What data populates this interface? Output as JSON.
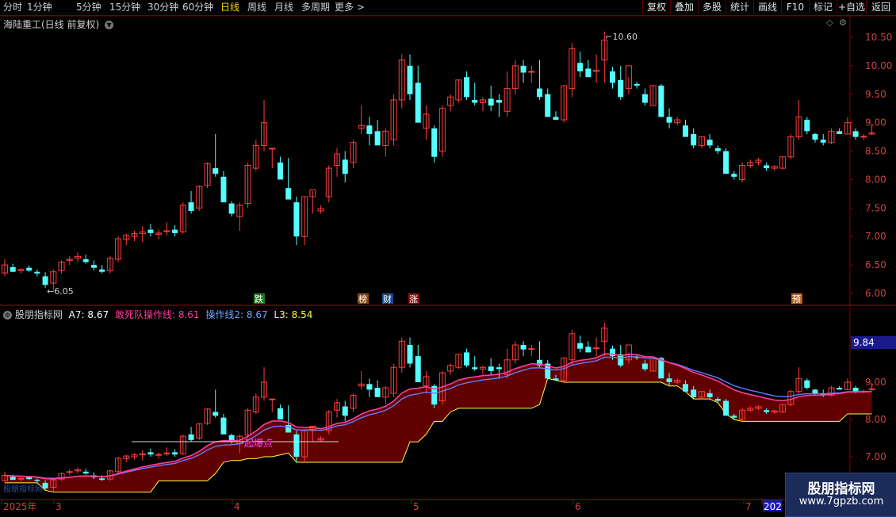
{
  "toolbar": {
    "periods": [
      "分时",
      "1分钟",
      "5分钟",
      "15分钟",
      "30分钟",
      "60分钟",
      "日线",
      "周线",
      "月线",
      "多周期",
      "更多 >"
    ],
    "active_period": "日线",
    "right_buttons": [
      "复权",
      "叠加",
      "多股",
      "统计",
      "画线",
      "F10",
      "标记",
      "+自选",
      "返回"
    ]
  },
  "main_pane": {
    "title": "海陆重工(日线 前复权)",
    "max_label": "10.60",
    "min_label": "6.05",
    "price_ticks": [
      "10.50",
      "10.00",
      "9.50",
      "9.00",
      "8.50",
      "8.00",
      "7.50",
      "7.00",
      "6.50",
      "6.00"
    ],
    "event_markers": [
      {
        "text": "跌",
        "bg": "#1f7a1f"
      },
      {
        "text": "榜",
        "bg": "#8a4a10"
      },
      {
        "text": "财",
        "bg": "#1f4a8a"
      },
      {
        "text": "涨",
        "bg": "#8a1010"
      },
      {
        "text": "预",
        "bg": "#b8601a"
      }
    ]
  },
  "indicator_pane": {
    "name": "股朋指标网",
    "values": [
      {
        "label": "A7:",
        "value": "8.67",
        "color": "#ffffff"
      },
      {
        "label": "敢死队操作线:",
        "value": "8.61",
        "color": "#ff3c9a"
      },
      {
        "label": "操作线2:",
        "value": "8.67",
        "color": "#6aa8ff"
      },
      {
        "label": "L3:",
        "value": "8.54",
        "color": "#ffff40"
      }
    ],
    "current_value": "9.84",
    "price_ticks": [
      "9.00",
      "8.00",
      "7.00"
    ],
    "annotation": "起爆点",
    "bottom_note": "股朋指标网"
  },
  "date_axis": [
    "2025年",
    "3",
    "4",
    "5",
    "6",
    "7",
    "202"
  ],
  "colors": {
    "up": "#ff3c3c",
    "down": "#54ffff",
    "bg": "#000000",
    "grid": "#7a0000",
    "ma": "#ff3c9a",
    "ma2": "#6a7aff",
    "l3": "#ffff40",
    "fill": "#6a0000"
  },
  "chart_data": {
    "type": "candlestick",
    "ohlc": [
      [
        6.36,
        6.6,
        6.3,
        6.5
      ],
      [
        6.46,
        6.52,
        6.38,
        6.38
      ],
      [
        6.4,
        6.44,
        6.35,
        6.42
      ],
      [
        6.45,
        6.49,
        6.38,
        6.4
      ],
      [
        6.38,
        6.42,
        6.3,
        6.35
      ],
      [
        6.3,
        6.37,
        6.1,
        6.15
      ],
      [
        6.18,
        6.42,
        6.05,
        6.38
      ],
      [
        6.4,
        6.58,
        6.35,
        6.55
      ],
      [
        6.58,
        6.66,
        6.5,
        6.6
      ],
      [
        6.62,
        6.72,
        6.55,
        6.65
      ],
      [
        6.6,
        6.68,
        6.52,
        6.55
      ],
      [
        6.5,
        6.58,
        6.4,
        6.45
      ],
      [
        6.42,
        6.5,
        6.35,
        6.38
      ],
      [
        6.4,
        6.65,
        6.35,
        6.62
      ],
      [
        6.6,
        7.0,
        6.55,
        6.96
      ],
      [
        6.95,
        7.05,
        6.85,
        7.02
      ],
      [
        7.0,
        7.1,
        6.92,
        7.05
      ],
      [
        7.05,
        7.18,
        6.9,
        7.08
      ],
      [
        7.12,
        7.22,
        7.0,
        7.06
      ],
      [
        7.04,
        7.12,
        6.95,
        7.06
      ],
      [
        7.1,
        7.25,
        7.02,
        7.1
      ],
      [
        7.12,
        7.2,
        7.0,
        7.06
      ],
      [
        7.08,
        7.6,
        7.05,
        7.55
      ],
      [
        7.6,
        7.8,
        7.4,
        7.45
      ],
      [
        7.5,
        7.9,
        7.45,
        7.88
      ],
      [
        7.9,
        8.3,
        7.85,
        8.28
      ],
      [
        8.2,
        8.8,
        8.05,
        8.1
      ],
      [
        8.05,
        8.15,
        7.7,
        7.6
      ],
      [
        7.58,
        7.62,
        7.35,
        7.4
      ],
      [
        7.35,
        7.6,
        7.1,
        7.55
      ],
      [
        7.58,
        8.3,
        7.5,
        8.25
      ],
      [
        8.2,
        8.7,
        8.15,
        8.6
      ],
      [
        8.6,
        9.4,
        8.5,
        9.0
      ],
      [
        8.55,
        8.55,
        8.2,
        8.55
      ],
      [
        8.3,
        8.4,
        8.1,
        8.0
      ],
      [
        7.85,
        8.38,
        7.65,
        7.65
      ],
      [
        7.6,
        7.7,
        6.85,
        7.0
      ],
      [
        7.0,
        7.7,
        6.85,
        7.7
      ],
      [
        7.7,
        7.8,
        7.4,
        7.82
      ],
      [
        7.45,
        7.55,
        7.4,
        7.49
      ],
      [
        7.7,
        8.25,
        7.6,
        8.2
      ],
      [
        8.25,
        8.55,
        8.05,
        8.45
      ],
      [
        8.35,
        8.5,
        7.95,
        8.1
      ],
      [
        8.3,
        8.7,
        8.2,
        8.65
      ],
      [
        8.9,
        9.3,
        8.8,
        8.95
      ],
      [
        8.95,
        9.1,
        8.6,
        8.8
      ],
      [
        8.85,
        9.05,
        8.6,
        8.6
      ],
      [
        8.6,
        8.9,
        8.4,
        8.85
      ],
      [
        8.7,
        9.5,
        8.6,
        9.4
      ],
      [
        9.4,
        10.2,
        9.25,
        10.1
      ],
      [
        10.0,
        10.2,
        9.4,
        9.5
      ],
      [
        9.7,
        10.0,
        9.05,
        9.0
      ],
      [
        8.9,
        9.3,
        8.7,
        9.15
      ],
      [
        8.9,
        8.95,
        8.3,
        8.4
      ],
      [
        8.5,
        9.3,
        8.4,
        9.25
      ],
      [
        9.3,
        9.5,
        9.2,
        9.45
      ],
      [
        9.4,
        9.75,
        9.35,
        9.75
      ],
      [
        9.8,
        9.9,
        9.4,
        9.45
      ],
      [
        9.4,
        9.7,
        9.3,
        9.35
      ],
      [
        9.35,
        9.45,
        9.2,
        9.4
      ],
      [
        9.42,
        9.65,
        9.2,
        9.3
      ],
      [
        9.4,
        9.5,
        9.1,
        9.35
      ],
      [
        9.2,
        9.9,
        9.1,
        9.6
      ],
      [
        9.6,
        10.1,
        9.5,
        10.0
      ],
      [
        10.0,
        10.1,
        9.7,
        9.88
      ],
      [
        9.9,
        10.0,
        9.7,
        9.9
      ],
      [
        9.6,
        10.1,
        9.4,
        9.45
      ],
      [
        9.5,
        9.6,
        9.2,
        9.1
      ],
      [
        9.1,
        9.2,
        9.05,
        9.05
      ],
      [
        9.05,
        9.65,
        9.0,
        9.65
      ],
      [
        9.6,
        10.4,
        9.45,
        10.3
      ],
      [
        10.05,
        10.25,
        9.8,
        9.9
      ],
      [
        9.95,
        10.1,
        9.8,
        9.8
      ],
      [
        9.9,
        10.2,
        9.7,
        9.92
      ],
      [
        10.1,
        10.6,
        9.7,
        10.45
      ],
      [
        9.9,
        9.98,
        9.6,
        9.7
      ],
      [
        9.75,
        10.0,
        9.4,
        9.45
      ],
      [
        9.6,
        9.8,
        9.5,
        10.0
      ],
      [
        9.68,
        9.72,
        9.6,
        9.65
      ],
      [
        9.5,
        9.6,
        9.3,
        9.35
      ],
      [
        9.3,
        9.65,
        9.3,
        9.65
      ],
      [
        9.65,
        9.68,
        9.15,
        9.1
      ],
      [
        9.1,
        9.25,
        8.9,
        9.0
      ],
      [
        9.0,
        9.1,
        8.95,
        9.05
      ],
      [
        8.95,
        9.05,
        8.75,
        8.75
      ],
      [
        8.8,
        8.9,
        8.55,
        8.6
      ],
      [
        8.6,
        8.75,
        8.55,
        8.75
      ],
      [
        8.7,
        8.8,
        8.55,
        8.6
      ],
      [
        8.55,
        8.6,
        8.45,
        8.5
      ],
      [
        8.5,
        8.55,
        8.15,
        8.1
      ],
      [
        8.1,
        8.15,
        8.0,
        8.05
      ],
      [
        8.0,
        8.3,
        7.95,
        8.25
      ],
      [
        8.25,
        8.35,
        8.2,
        8.3
      ],
      [
        8.3,
        8.38,
        8.25,
        8.34
      ],
      [
        8.25,
        8.3,
        8.15,
        8.2
      ],
      [
        8.2,
        8.25,
        8.15,
        8.23
      ],
      [
        8.2,
        8.4,
        8.18,
        8.4
      ],
      [
        8.4,
        8.8,
        8.35,
        8.75
      ],
      [
        8.75,
        9.4,
        8.7,
        9.1
      ],
      [
        9.05,
        9.1,
        8.8,
        8.85
      ],
      [
        8.8,
        8.82,
        8.65,
        8.7
      ],
      [
        8.7,
        8.8,
        8.6,
        8.65
      ],
      [
        8.65,
        8.9,
        8.62,
        8.85
      ],
      [
        8.85,
        8.9,
        8.8,
        8.8
      ],
      [
        8.8,
        9.1,
        8.8,
        9.0
      ],
      [
        8.85,
        8.9,
        8.7,
        8.75
      ],
      [
        8.75,
        8.8,
        8.7,
        8.76
      ],
      [
        8.8,
        8.98,
        8.78,
        8.82
      ]
    ],
    "max_price": 10.6,
    "min_price": 6.05,
    "indicator_lines": [
      "A7",
      "敢死队操作线",
      "操作线2",
      "L3"
    ]
  }
}
